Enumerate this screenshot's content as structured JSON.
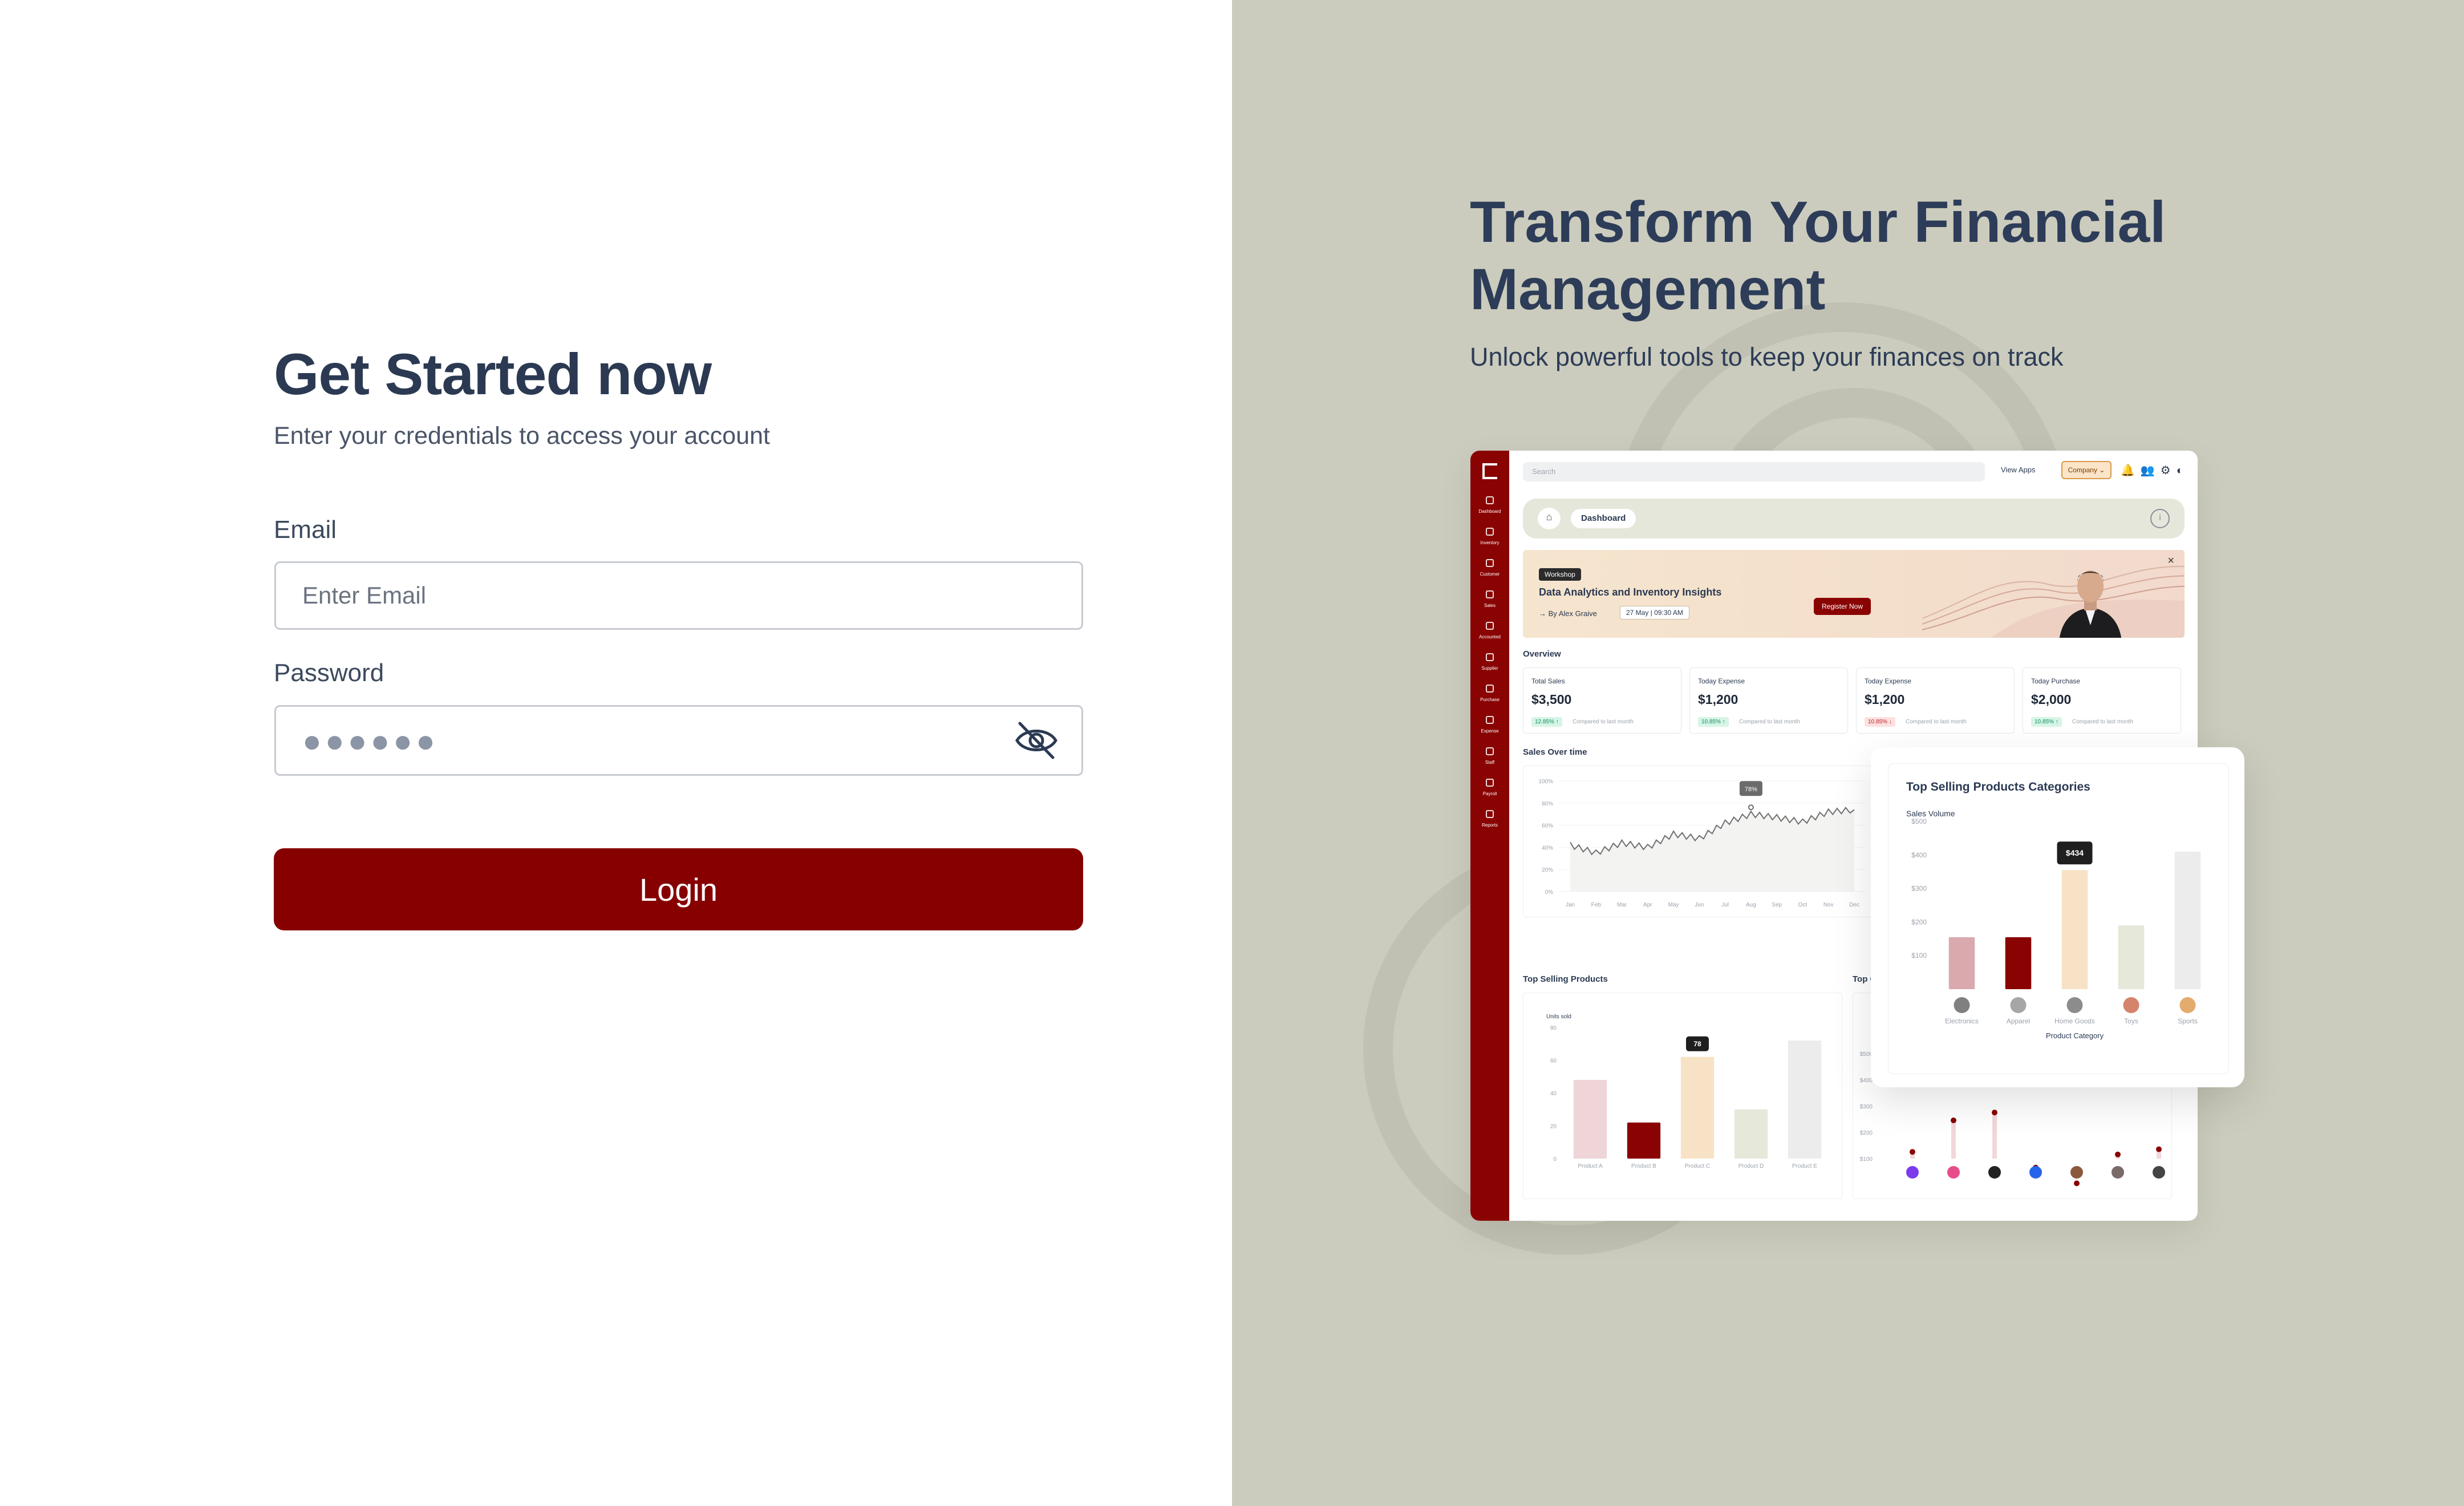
{
  "login": {
    "title": "Get Started now",
    "subtitle": "Enter your credentials to access your account",
    "email_label": "Email",
    "email_placeholder": "Enter Email",
    "password_label": "Password",
    "password_value": "●●●●●●",
    "login_label": "Login"
  },
  "promo": {
    "title": "Transform Your Financial Management",
    "subtitle": "Unlock powerful tools to keep your finances on track"
  },
  "dashboard": {
    "search_placeholder": "Search",
    "view_apps": "View Apps",
    "company": "Company ⌄",
    "breadcrumb": "Dashboard",
    "sidebar": [
      "Dashboard",
      "Inventory",
      "Customer",
      "Sales",
      "Accounted",
      "Supplier",
      "Purchase",
      "Expense",
      "Staff",
      "Payroll",
      "Reports"
    ],
    "banner": {
      "tag": "Workshop",
      "title": "Data Analytics and Inventory Insights",
      "author": "By Alex Graive",
      "date": "27 May | 09:30 AM",
      "button": "Register Now"
    },
    "overview_title": "Overview",
    "cards": [
      {
        "title": "Total Sales",
        "value": "$3,500",
        "badge": "12.85% ↑",
        "trend": "up",
        "compare": "Compared to last month"
      },
      {
        "title": "Today Expense",
        "value": "$1,200",
        "badge": "10.85% ↑",
        "trend": "up",
        "compare": "Compared to last month"
      },
      {
        "title": "Today Expense",
        "value": "$1,200",
        "badge": "10.85% ↓",
        "trend": "down",
        "compare": "Compared to last month"
      },
      {
        "title": "Today Purchase",
        "value": "$2,000",
        "badge": "10.85% ↑",
        "trend": "up",
        "compare": "Compared to last month"
      }
    ],
    "sales_over_time_title": "Sales Over time",
    "top_selling_products_title": "Top Selling Products",
    "top_categories_partial_title": "Top C",
    "colors": {
      "brand": "#870000",
      "sidebar": "#8a0303",
      "promo_bg": "#cbccbd",
      "heading": "#2b3a52"
    }
  },
  "chart_data": [
    {
      "type": "line",
      "title": "Sales Over time",
      "x": [
        "Jan",
        "Feb",
        "Mar",
        "Apr",
        "May",
        "Jun",
        "Jul",
        "Aug",
        "Sep",
        "Oct",
        "Nov",
        "Dec"
      ],
      "ytick_labels": [
        "0%",
        "20%",
        "40%",
        "60%",
        "80%",
        "100%"
      ],
      "ylim": [
        0,
        100
      ],
      "series": [
        {
          "values": [
            42,
            35,
            44,
            40,
            52,
            48,
            62,
            70,
            67,
            63,
            72,
            74
          ]
        }
      ],
      "annotation": "78%",
      "grid": true
    },
    {
      "type": "bar",
      "title": "Top Selling Products",
      "ylabel": "Units sold",
      "categories": [
        "Product A",
        "Product B",
        "Product C",
        "Product D",
        "Product E"
      ],
      "values": [
        48,
        22,
        62,
        30,
        72
      ],
      "ytick_labels": [
        "0",
        "20",
        "40",
        "60",
        "80"
      ],
      "ylim": [
        0,
        80
      ],
      "annotation": "78",
      "colors": [
        "#efd5d8",
        "#8a0303",
        "#f7e2c6",
        "#e6e8da",
        "#ececec"
      ]
    },
    {
      "type": "bar",
      "title": "Top Selling Products Categories",
      "ylabel": "Sales Volume",
      "xlabel": "Product Category",
      "categories": [
        "Electronics",
        "Apparel",
        "Home Goods",
        "Toys",
        "Sports"
      ],
      "values": [
        155,
        155,
        355,
        190,
        410
      ],
      "ytick_labels": [
        "$100",
        "$200",
        "$300",
        "$400",
        "$500"
      ],
      "ylim": [
        0,
        500
      ],
      "annotation": "$434",
      "colors": [
        "#d9a9ae",
        "#8a0303",
        "#f7e2c6",
        "#e6e8da",
        "#ececec"
      ]
    },
    {
      "type": "scatter",
      "title": "Top C",
      "ytick_labels": [
        "$100",
        "$200",
        "$300",
        "$400",
        "$500"
      ],
      "values": [
        330,
        450,
        480,
        270,
        210,
        320,
        340
      ]
    }
  ]
}
